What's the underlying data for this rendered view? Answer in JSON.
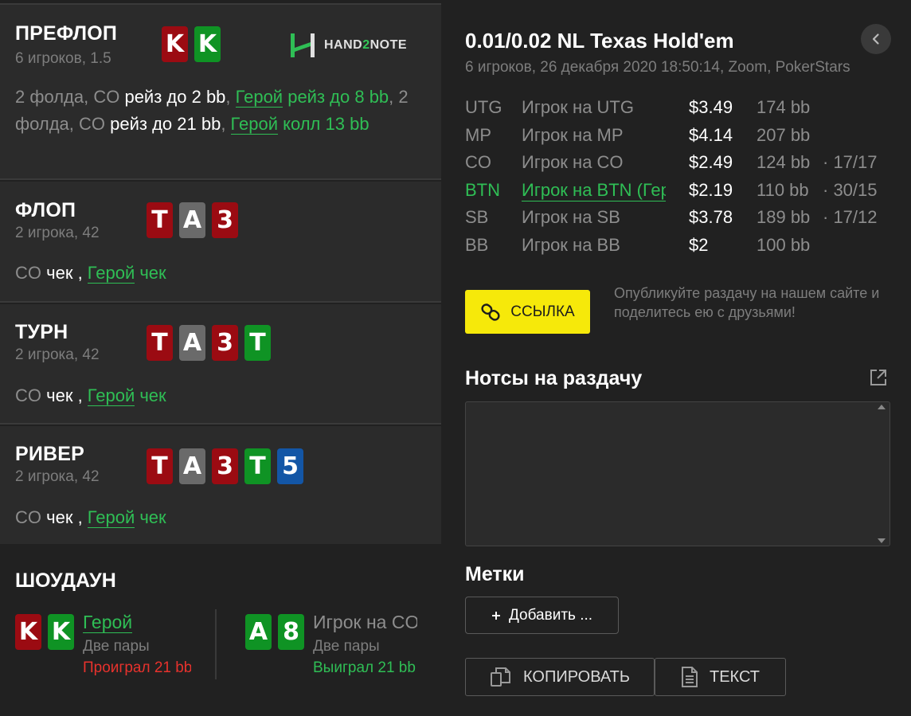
{
  "streets": {
    "preflop": {
      "title": "ПРЕФЛОП",
      "sub": "6 игроков, 1.5",
      "cards": [
        "K",
        "K"
      ],
      "action": {
        "p1": "2 фолда, CO ",
        "p2": "рейз до 2 bb",
        "p3": ", ",
        "hero1": "Герой",
        "p4": " рейз до 8 bb",
        "p5": ", 2 фолда, CO ",
        "p6": "рейз до 21 bb",
        "p7": ", ",
        "hero2": "Герой",
        "p8": " колл 13 bb"
      }
    },
    "flop": {
      "title": "ФЛОП",
      "sub": "2 игрока, 42",
      "cards": [
        "T",
        "A",
        "3"
      ],
      "action": {
        "p1": "CO ",
        "p2": "чек",
        "p3": " , ",
        "hero": "Герой",
        "p4": " чек"
      }
    },
    "turn": {
      "title": "ТУРН",
      "sub": "2 игрока, 42",
      "cards": [
        "T",
        "A",
        "3",
        "T"
      ],
      "action": {
        "p1": "CO ",
        "p2": "чек",
        "p3": " , ",
        "hero": "Герой",
        "p4": " чек"
      }
    },
    "river": {
      "title": "РИВЕР",
      "sub": "2 игрока, 42",
      "cards": [
        "T",
        "A",
        "3",
        "T",
        "5"
      ],
      "action": {
        "p1": "CO ",
        "p2": "чек",
        "p3": " , ",
        "hero": "Герой",
        "p4": " чек"
      }
    }
  },
  "logo": {
    "part1": "HAND",
    "part2": "2",
    "part3": "NOTE"
  },
  "showdown": {
    "title": "ШОУДАУН",
    "players": [
      {
        "cards": [
          "K",
          "K"
        ],
        "name": "Герой",
        "hand": "Две пары",
        "result": "Проиграл 21 bb"
      },
      {
        "cards": [
          "A",
          "8"
        ],
        "name": "Игрок на CO",
        "hand": "Две пары",
        "result": "Выиграл 21 bb"
      }
    ]
  },
  "game": {
    "title": "0.01/0.02 NL Texas Hold'em",
    "sub": "6 игроков, 26 декабря 2020 18:50:14, Zoom, PokerStars"
  },
  "players": [
    {
      "pos": "UTG",
      "name": "Игрок на UTG",
      "stack": "$3.49",
      "bb": "174 bb",
      "stat": ""
    },
    {
      "pos": "MP",
      "name": "Игрок на MP",
      "stack": "$4.14",
      "bb": "207 bb",
      "stat": ""
    },
    {
      "pos": "CO",
      "name": "Игрок на CO",
      "stack": "$2.49",
      "bb": "124 bb",
      "stat": "·  17/17"
    },
    {
      "pos": "BTN",
      "name": "Игрок на BTN (Герой)",
      "stack": "$2.19",
      "bb": "110 bb",
      "stat": "·  30/15"
    },
    {
      "pos": "SB",
      "name": "Игрок на SB",
      "stack": "$3.78",
      "bb": "189 bb",
      "stat": "·  17/12"
    },
    {
      "pos": "BB",
      "name": "Игрок на BB",
      "stack": "$2",
      "bb": "100 bb",
      "stat": ""
    }
  ],
  "share": {
    "button": "ССЫЛКА",
    "text": "Опубликуйте раздачу на нашем сайте и поделитесь ею с друзьями!"
  },
  "notes": {
    "title": "Нотсы на раздачу",
    "value": ""
  },
  "tags": {
    "title": "Метки",
    "add_button": "Добавить ..."
  },
  "footer": {
    "copy_button": "КОПИРОВАТЬ",
    "text_button": "ТЕКСТ"
  },
  "icons": {
    "back": "chevron-left-icon",
    "link": "chain-link-icon",
    "external": "external-link-icon",
    "copy": "copy-icon",
    "text": "document-icon",
    "plus": "plus-icon"
  }
}
